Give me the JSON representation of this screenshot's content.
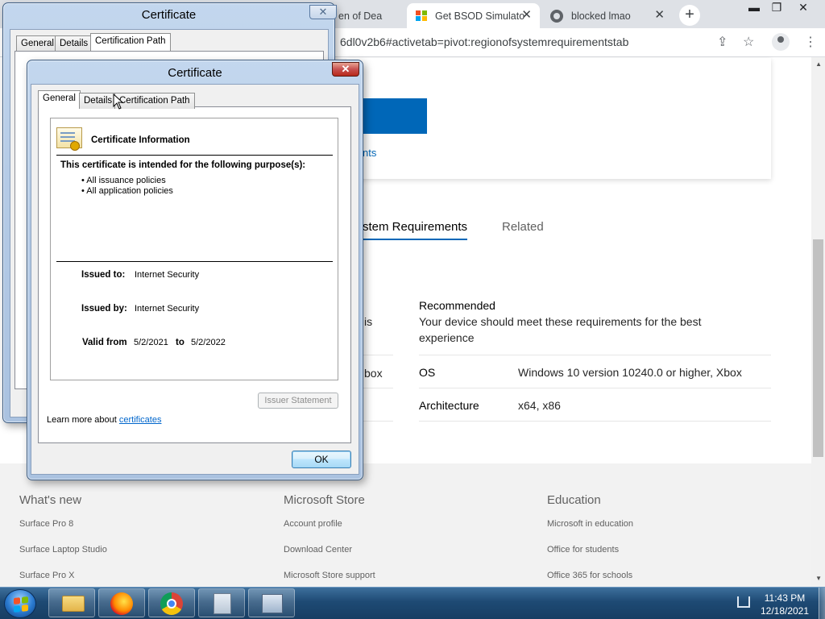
{
  "browser": {
    "tabs": [
      {
        "label": "en of Dea"
      },
      {
        "label": "Get BSOD Simulato",
        "active": true
      },
      {
        "label": "blocked lmao"
      }
    ],
    "new_tab": "+",
    "url": "6dl0v2b6#activetab=pivot:regionofsystemrequirementstab",
    "window_controls": {
      "minimize": "▬",
      "restore": "❐",
      "close": "✕"
    }
  },
  "page": {
    "more_link": "nts",
    "tabs": {
      "system_requirements": "stem Requirements",
      "related": "Related"
    },
    "left_col": {
      "row1": "is",
      "row2": "box"
    },
    "recommended": {
      "title": "Recommended",
      "desc_line1": "Your device should meet these requirements for the best",
      "desc_line2": "experience"
    },
    "rows": [
      {
        "label": "OS",
        "value": "Windows 10 version 10240.0 or higher, Xbox"
      },
      {
        "label": "Architecture",
        "value": "x64, x86"
      }
    ],
    "footer": {
      "columns": [
        {
          "heading": "What's new",
          "links": [
            "Surface Pro 8",
            "Surface Laptop Studio",
            "Surface Pro X"
          ]
        },
        {
          "heading": "Microsoft Store",
          "links": [
            "Account profile",
            "Download Center",
            "Microsoft Store support"
          ]
        },
        {
          "heading": "Education",
          "links": [
            "Microsoft in education",
            "Office for students",
            "Office 365 for schools"
          ]
        }
      ]
    }
  },
  "back_dialog": {
    "title": "Certificate",
    "tabs": [
      "General",
      "Details",
      "Certification Path"
    ]
  },
  "dialog": {
    "title": "Certificate",
    "tabs": [
      "General",
      "Details",
      "Certification Path"
    ],
    "heading": "Certificate Information",
    "purpose_title": "This certificate is intended for the following purpose(s):",
    "purposes": [
      "• All issuance policies",
      "• All application policies"
    ],
    "issued_to_label": "Issued to:",
    "issued_to": "Internet Security",
    "issued_by_label": "Issued by:",
    "issued_by": "Internet Security",
    "valid_from_label": "Valid from",
    "valid_from": "5/2/2021",
    "to_label": "to",
    "valid_to": "5/2/2022",
    "issuer_statement": "Issuer Statement",
    "learn_more": "Learn more about",
    "learn_link": "certificates",
    "ok": "OK"
  },
  "taskbar": {
    "time": "11:43 PM",
    "date": "12/18/2021"
  },
  "colors": {
    "accent": "#0067b8",
    "ms_red": "#f25022",
    "ms_green": "#7fba00",
    "ms_blue": "#00a4ef",
    "ms_yellow": "#ffb900"
  }
}
